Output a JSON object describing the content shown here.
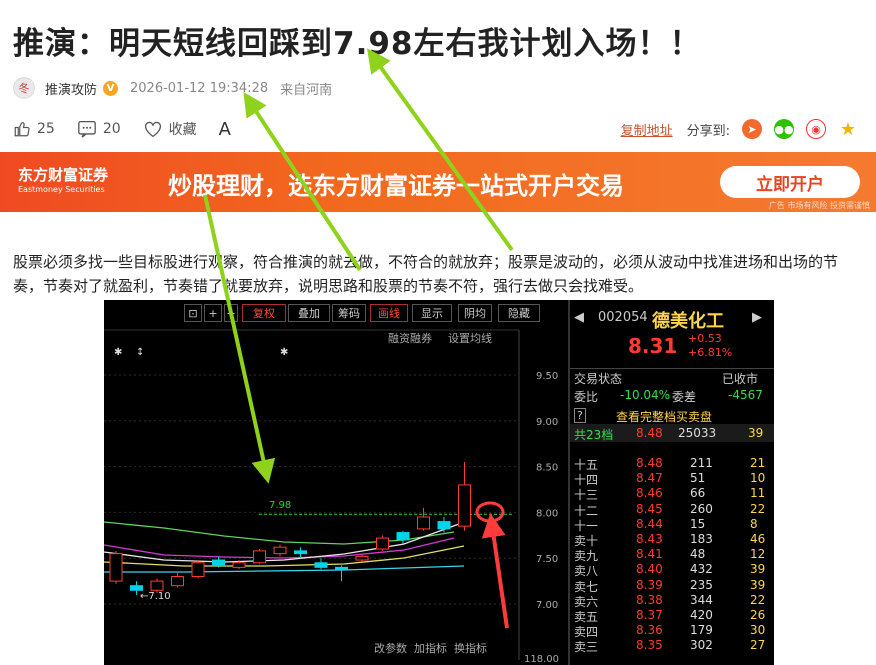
{
  "article": {
    "title": "推演：明天短线回踩到7.98左右我计划入场！！",
    "author": "推演攻防",
    "avatar_text": "冬",
    "verified_badge": "V",
    "date": "2026-01-12 19:34:28",
    "location": "来自河南",
    "likes": "25",
    "comments": "20",
    "collect_label": "收藏",
    "font_label": "A",
    "copy_link": "复制地址",
    "share_label": "分享到:",
    "share_icons": [
      "share-app-icon",
      "wechat-icon",
      "weibo-icon",
      "star-icon"
    ],
    "body": "股票必须多找一些目标股进行观察，符合推演的就去做，不符合的就放弃；股票是波动的，必须从波动中找准进场和出场的节奏，节奏对了就盈利，节奏错了就要放弃，说明思路和股票的节奏不符，强行去做只会找难受。"
  },
  "banner": {
    "brand_cn": "东方财富证券",
    "brand_en": "Eastmoney Securities",
    "slogan": "炒股理财，选东方财富证券一站式开户交易",
    "button": "立即开户",
    "note": "广告 市场有风险 投资需谨慎"
  },
  "chart_toolbar": {
    "items": [
      "复权",
      "叠加",
      "筹码",
      "画线",
      "显示",
      "阴均",
      "隐藏"
    ],
    "sub_labels": [
      "融资融券",
      "设置均线"
    ],
    "bottom": [
      "改参数",
      "加指标",
      "换指标"
    ]
  },
  "chart_data": {
    "type": "candlestick",
    "y_ticks": [
      "9.50",
      "9.00",
      "8.50",
      "8.00",
      "7.50",
      "7.00"
    ],
    "ylim": [
      6.6,
      9.9
    ],
    "annotations": {
      "horizontal_line_value": 7.98,
      "horizontal_line_label": "7.98",
      "low_label": "←7.10",
      "volume_label": "118.00"
    },
    "candles": [
      {
        "o": 7.25,
        "c": 7.55,
        "h": 7.58,
        "l": 7.22
      },
      {
        "o": 7.2,
        "c": 7.15,
        "h": 7.25,
        "l": 7.1
      },
      {
        "o": 7.15,
        "c": 7.25,
        "h": 7.28,
        "l": 7.12
      },
      {
        "o": 7.2,
        "c": 7.3,
        "h": 7.35,
        "l": 7.18
      },
      {
        "o": 7.3,
        "c": 7.45,
        "h": 7.48,
        "l": 7.28
      },
      {
        "o": 7.48,
        "c": 7.42,
        "h": 7.52,
        "l": 7.4
      },
      {
        "o": 7.4,
        "c": 7.45,
        "h": 7.48,
        "l": 7.38
      },
      {
        "o": 7.45,
        "c": 7.58,
        "h": 7.6,
        "l": 7.44
      },
      {
        "o": 7.55,
        "c": 7.62,
        "h": 7.65,
        "l": 7.52
      },
      {
        "o": 7.58,
        "c": 7.55,
        "h": 7.62,
        "l": 7.5
      },
      {
        "o": 7.45,
        "c": 7.4,
        "h": 7.5,
        "l": 7.38
      },
      {
        "o": 7.4,
        "c": 7.38,
        "h": 7.42,
        "l": 7.25
      },
      {
        "o": 7.48,
        "c": 7.52,
        "h": 7.55,
        "l": 7.46
      },
      {
        "o": 7.6,
        "c": 7.72,
        "h": 7.75,
        "l": 7.58
      },
      {
        "o": 7.78,
        "c": 7.7,
        "h": 7.8,
        "l": 7.66
      },
      {
        "o": 7.82,
        "c": 7.95,
        "h": 8.05,
        "l": 7.8
      },
      {
        "o": 7.9,
        "c": 7.82,
        "h": 7.95,
        "l": 7.78
      },
      {
        "o": 7.85,
        "c": 8.3,
        "h": 8.55,
        "l": 7.8
      }
    ]
  },
  "quote": {
    "code": "002054",
    "name": "德美化工",
    "price": "8.31",
    "change": "+0.53",
    "pct": "+6.81%",
    "status_label": "交易状态",
    "status": "已收市",
    "ratio_label": "委比",
    "ratio": "-10.04%",
    "diff_label": "委差",
    "diff": "-4567",
    "full_label": "查看完整档买卖盘",
    "summary": {
      "label": "共23档",
      "price": "8.48",
      "vol": "25033",
      "count": "39"
    },
    "sell_rows": [
      {
        "label": "十五",
        "price": "8.48",
        "vol": "211",
        "count": "21"
      },
      {
        "label": "十四",
        "price": "8.47",
        "vol": "51",
        "count": "10"
      },
      {
        "label": "十三",
        "price": "8.46",
        "vol": "66",
        "count": "11"
      },
      {
        "label": "十二",
        "price": "8.45",
        "vol": "260",
        "count": "22"
      },
      {
        "label": "十一",
        "price": "8.44",
        "vol": "15",
        "count": "8"
      },
      {
        "label": "卖十",
        "price": "8.43",
        "vol": "183",
        "count": "46"
      },
      {
        "label": "卖九",
        "price": "8.41",
        "vol": "48",
        "count": "12"
      },
      {
        "label": "卖八",
        "price": "8.40",
        "vol": "432",
        "count": "39"
      },
      {
        "label": "卖七",
        "price": "8.39",
        "vol": "235",
        "count": "39"
      },
      {
        "label": "卖六",
        "price": "8.38",
        "vol": "344",
        "count": "22"
      },
      {
        "label": "卖五",
        "price": "8.37",
        "vol": "420",
        "count": "26"
      },
      {
        "label": "卖四",
        "price": "8.36",
        "vol": "179",
        "count": "30"
      },
      {
        "label": "卖三",
        "price": "8.35",
        "vol": "302",
        "count": "27"
      }
    ]
  },
  "colors": {
    "up": "#ff3b30",
    "down": "#00d4e8",
    "accent": "#e8441f",
    "arrow": "#8ed21b"
  }
}
